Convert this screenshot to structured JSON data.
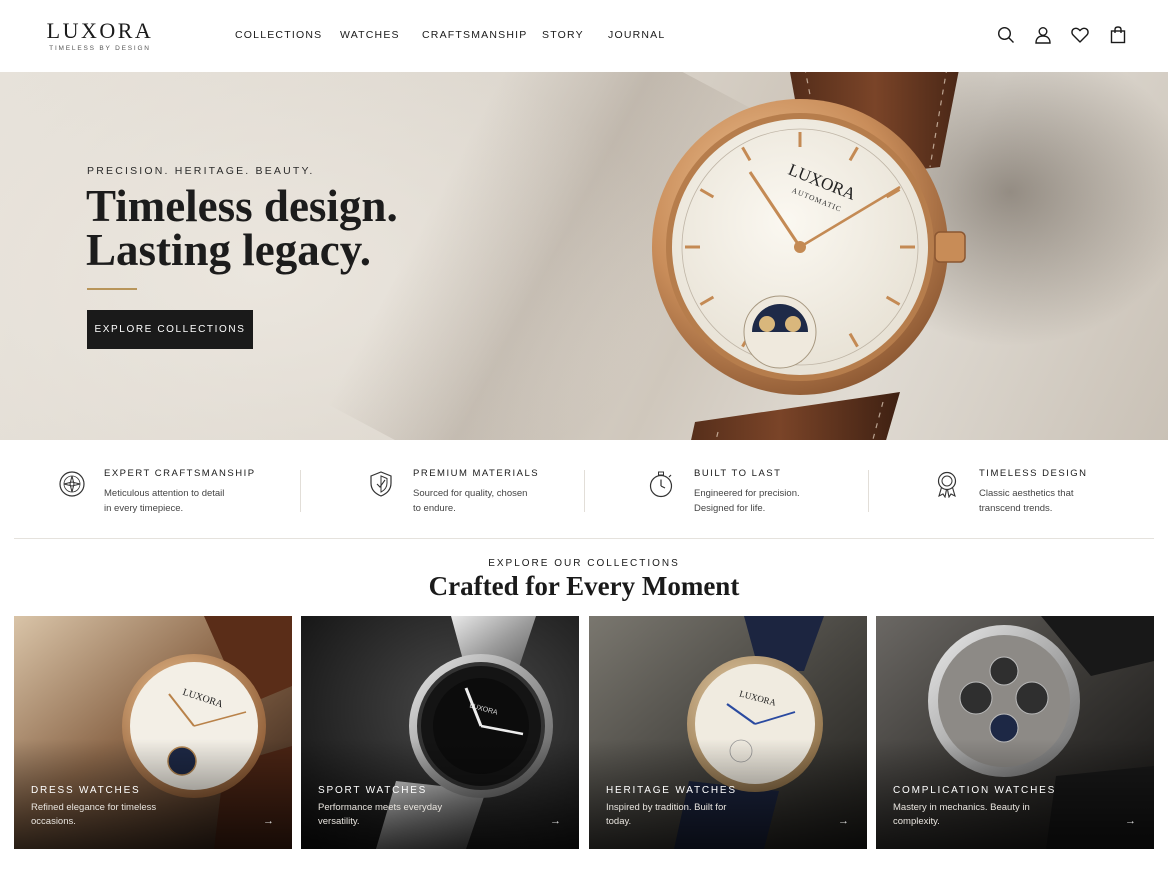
{
  "brand": {
    "name": "LUXORA",
    "tagline": "TIMELESS BY DESIGN"
  },
  "nav": {
    "links": [
      "COLLECTIONS",
      "WATCHES",
      "CRAFTSMANSHIP",
      "STORY",
      "JOURNAL"
    ],
    "icons": [
      "search-icon",
      "account-icon",
      "wishlist-heart-icon",
      "shopping-bag-icon"
    ]
  },
  "hero": {
    "eyebrow": "PRECISION. HERITAGE. BEAUTY.",
    "title_line1": "Timeless design.",
    "title_line2": "Lasting legacy.",
    "cta": "EXPLORE COLLECTIONS",
    "watch_dial_text1": "LUXORA",
    "watch_dial_text2": "AUTOMATIC"
  },
  "features": [
    {
      "icon": "compass-icon",
      "title": "EXPERT CRAFTSMANSHIP",
      "desc": "Meticulous attention to detail\nin every timepiece."
    },
    {
      "icon": "shield-icon",
      "title": "PREMIUM MATERIALS",
      "desc": "Sourced for quality, chosen\nto endure."
    },
    {
      "icon": "stopwatch-icon",
      "title": "BUILT TO LAST",
      "desc": "Engineered for precision.\nDesigned for life."
    },
    {
      "icon": "ribbon-award-icon",
      "title": "TIMELESS DESIGN",
      "desc": "Classic aesthetics that\ntranscend trends."
    }
  ],
  "collections": {
    "eyebrow": "EXPLORE OUR COLLECTIONS",
    "title": "Crafted for Every Moment",
    "cards": [
      {
        "title": "DRESS WATCHES",
        "desc": "Refined elegance for timeless occasions.",
        "arrow": "→"
      },
      {
        "title": "SPORT WATCHES",
        "desc": "Performance meets everyday versatility.",
        "arrow": "→"
      },
      {
        "title": "HERITAGE WATCHES",
        "desc": "Inspired by tradition. Built for today.",
        "arrow": "→"
      },
      {
        "title": "COMPLICATION WATCHES",
        "desc": "Mastery in mechanics. Beauty in complexity.",
        "arrow": "→"
      }
    ]
  },
  "colors": {
    "accent_gold": "#b8955a",
    "button_dark": "#1a1a1a"
  }
}
